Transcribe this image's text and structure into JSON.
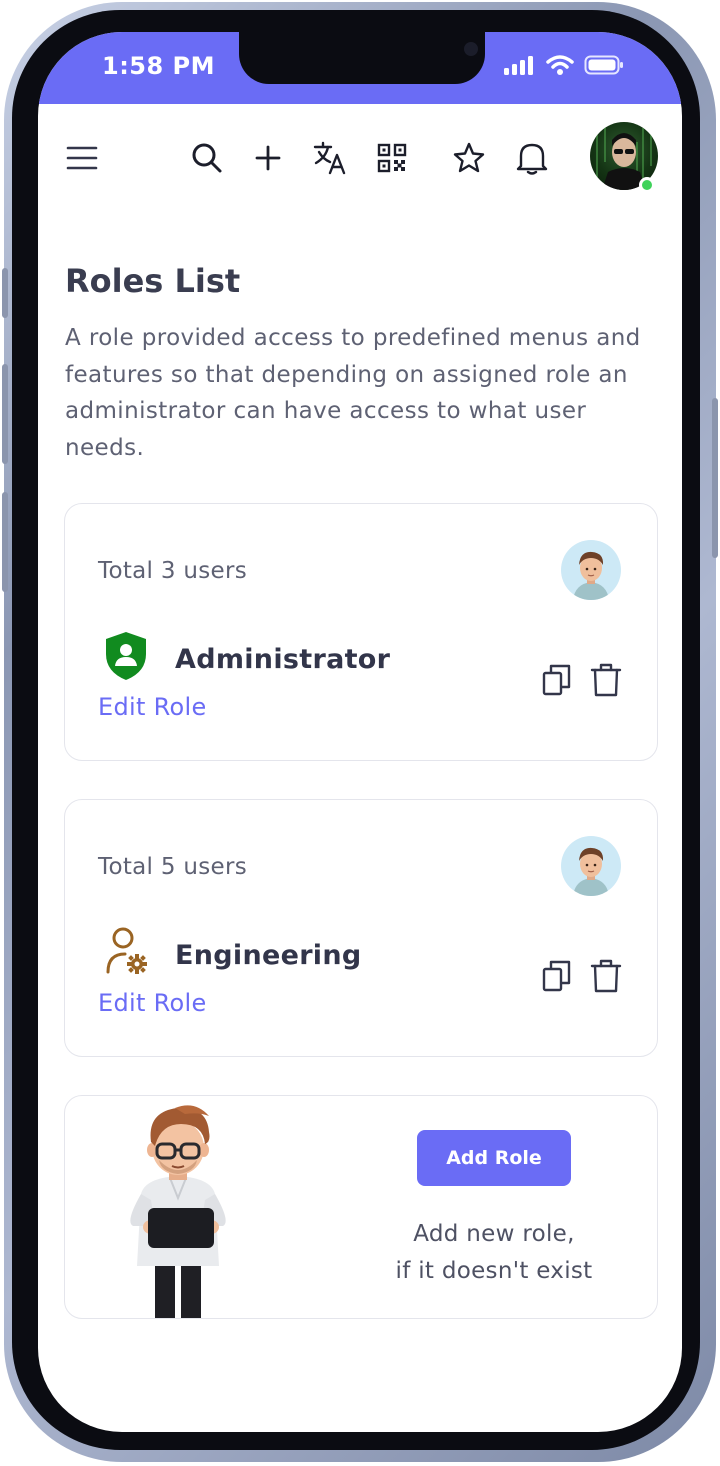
{
  "status_bar": {
    "time": "1:58 PM",
    "icons": [
      "cellular-signal-icon",
      "wifi-icon",
      "battery-icon"
    ],
    "background": "#6a6cf5"
  },
  "nav": {
    "icons": [
      "menu-icon",
      "search-icon",
      "plus-icon",
      "translate-icon",
      "qr-code-icon",
      "star-icon",
      "bell-icon"
    ],
    "avatar": "profile-avatar",
    "online_color": "#3fd25a"
  },
  "page": {
    "title": "Roles List",
    "description": "A role provided access to predefined menus and features so that depending on assigned role an administrator can have access to what user needs."
  },
  "roles": [
    {
      "total": "Total 3 users",
      "name": "Administrator",
      "edit_label": "Edit Role",
      "icon": "shield-user-icon",
      "icon_color": "#118b1f"
    },
    {
      "total": "Total 5 users",
      "name": "Engineering",
      "edit_label": "Edit Role",
      "icon": "user-gear-icon",
      "icon_color": "#9a6423"
    }
  ],
  "add_role": {
    "button_label": "Add Role",
    "text_line1": "Add new role,",
    "text_line2": "if it doesn't exist"
  },
  "accent_color": "#6a6cf5"
}
